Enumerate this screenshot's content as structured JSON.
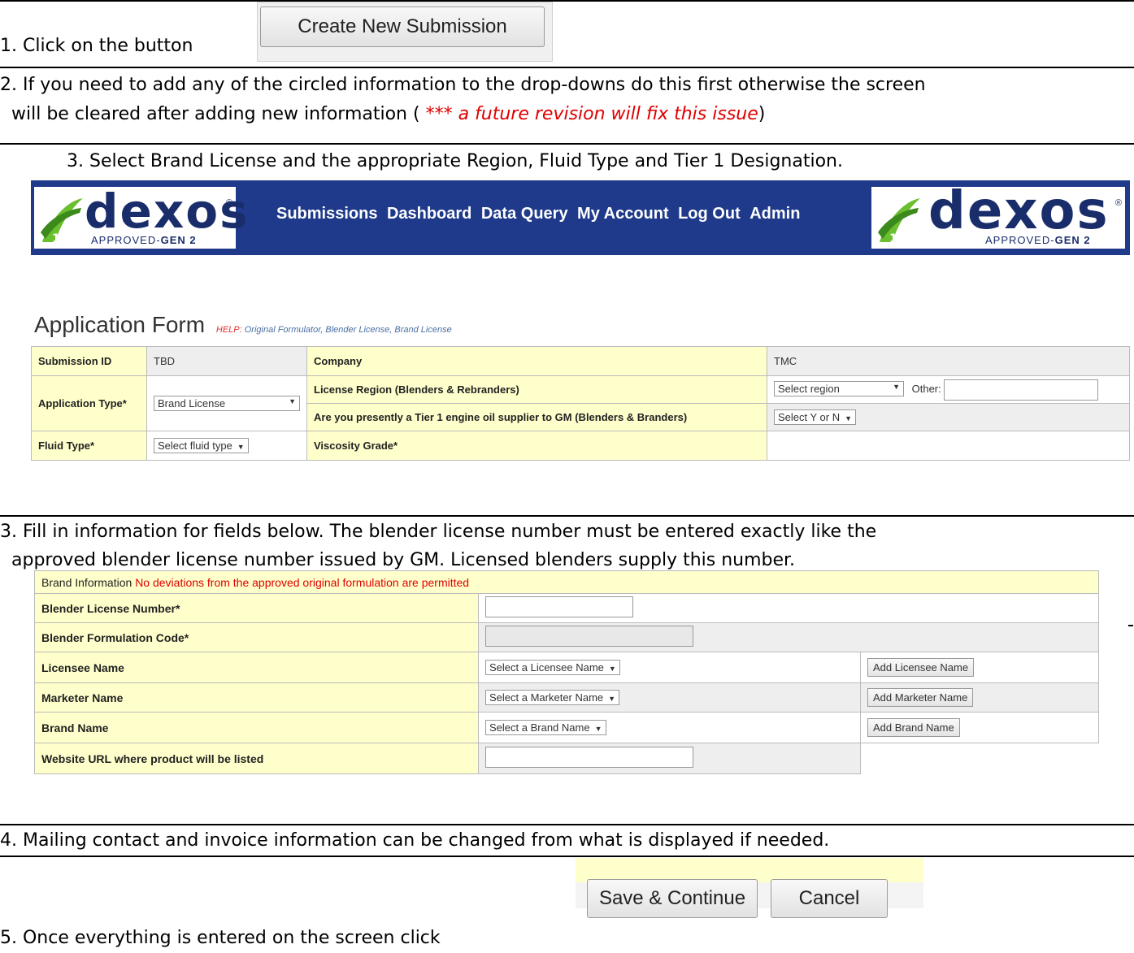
{
  "step1": {
    "text": "1. Click on the button",
    "button": "Create New Submission"
  },
  "step2": {
    "line1": "2. If you need to add any of the circled information to the drop-downs do this first otherwise the screen",
    "line2_pre": "will be cleared after adding new information (",
    "line2_note": "*** a future revision will fix this issue",
    "line2_post": ")"
  },
  "step3a": {
    "text": "3.  Select Brand License and the appropriate Region, Fluid Type and Tier 1 Designation."
  },
  "nav": {
    "logo_word": "dexos",
    "logo_sub_a": "APPROVED-",
    "logo_sub_b": "GEN 2",
    "logo_reg": "®",
    "links": [
      "Submissions",
      "Dashboard",
      "Data Query",
      "My Account",
      "Log Out",
      "Admin"
    ]
  },
  "app_form": {
    "title": "Application Form",
    "help_label": "HELP:",
    "help_links": "Original Formulator, Blender License, Brand   License",
    "submission_id_label": "Submission ID",
    "submission_id_value": "TBD",
    "company_label": "Company",
    "company_value": "TMC",
    "application_type_label": "Application Type*",
    "application_type_value": "Brand License",
    "license_region_label": "License Region (Blenders & Rebranders)",
    "region_select": "Select region",
    "other_label": "Other:",
    "tier1_label": "Are you presently a Tier 1 engine oil supplier to GM (Blenders & Branders)",
    "tier1_select": "Select Y or N",
    "fluid_type_label": "Fluid Type*",
    "fluid_type_select": "Select fluid type",
    "viscosity_label": "Viscosity Grade*"
  },
  "step3b": {
    "line1": "3. Fill in information for fields below.  The blender license number must be entered exactly like the",
    "line2": "approved blender license number issued by GM.  Licensed blenders supply this number."
  },
  "brand_form": {
    "header_label": "Brand Information",
    "header_warning": "No deviations from the approved original formulation are permitted",
    "blender_license_label": "Blender License Number*",
    "formulation_code_label": "Blender Formulation Code*",
    "licensee_label": "Licensee Name",
    "licensee_select": "Select a Licensee Name",
    "licensee_add": "Add Licensee Name",
    "marketer_label": "Marketer Name",
    "marketer_select": "Select a Marketer Name",
    "marketer_add": "Add Marketer Name",
    "brand_label": "Brand Name",
    "brand_select": "Select a Brand Name",
    "brand_add": "Add Brand Name",
    "website_label": "Website URL where product will be listed"
  },
  "step4": {
    "text": "4. Mailing contact and invoice information can be changed from what is displayed if needed."
  },
  "step5": {
    "text": "5. Once everything is entered on the screen click",
    "save": "Save & Continue",
    "cancel": "Cancel"
  },
  "colors": {
    "nav_bg": "#1f3a8a",
    "label_bg": "#ffffcc",
    "note_red": "#e00000"
  }
}
